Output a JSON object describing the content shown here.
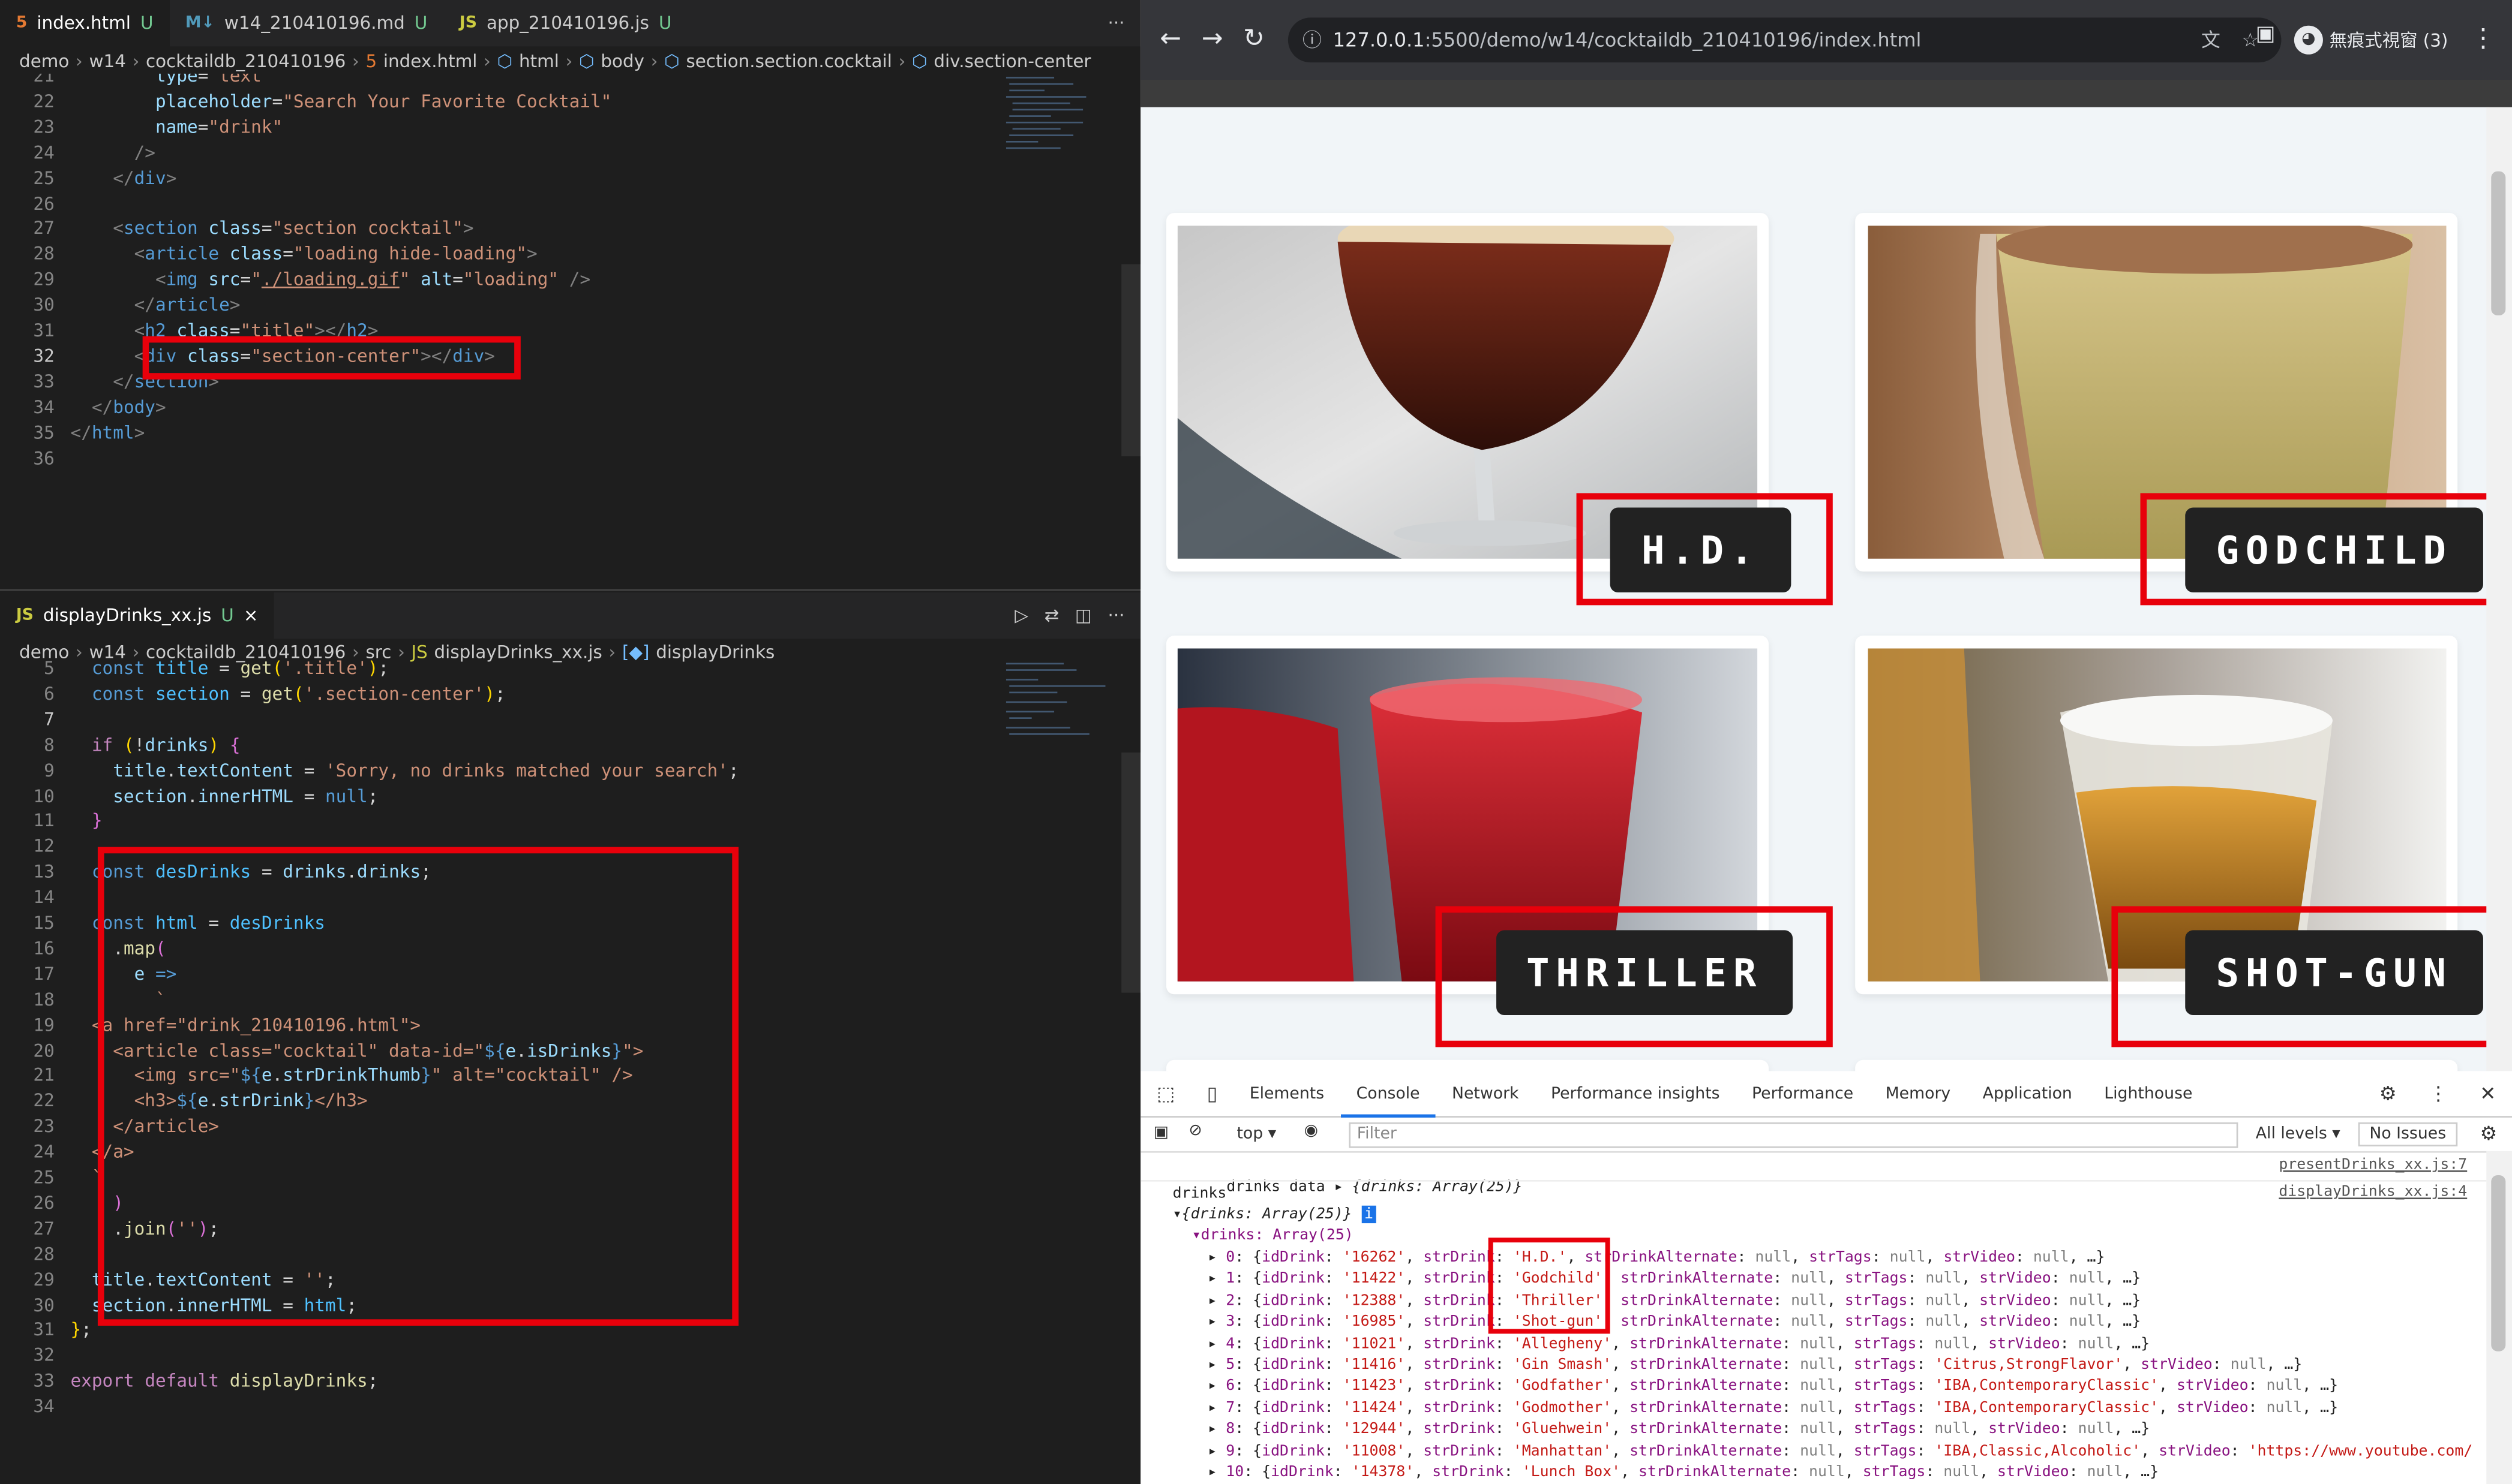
{
  "editor_top": {
    "tabs": [
      {
        "icon": "<>",
        "label": "index.html",
        "status": "U"
      },
      {
        "icon": "M↓",
        "label": "w14_210410196.md",
        "status": "U"
      },
      {
        "icon": "JS",
        "label": "app_210410196.js",
        "status": "U"
      }
    ],
    "more": "···",
    "breadcrumb": [
      "demo",
      "w14",
      "cocktaildb_210410196",
      "index.html",
      "html",
      "body",
      "section.section.cocktail",
      "div.section-center"
    ]
  },
  "editor_bottom": {
    "tab": {
      "icon": "JS",
      "label": "displayDrinks_xx.js",
      "status": "U",
      "close": "×"
    },
    "more": "···",
    "breadcrumb": [
      "demo",
      "w14",
      "cocktaildb_210410196",
      "src",
      "displayDrinks_xx.js",
      "displayDrinks"
    ]
  },
  "browser": {
    "url_host": "127.0.0.1",
    "url_rest": ":5500/demo/w14/cocktaildb_210410196/index.html",
    "profile": "無痕式視窗 (3)",
    "drinks": [
      "H.D.",
      "GODCHILD",
      "THRILLER",
      "SHOT-GUN"
    ]
  },
  "devtools": {
    "tabs": [
      "Elements",
      "Console",
      "Network",
      "Performance insights",
      "Performance",
      "Memory",
      "Application",
      "Lighthouse"
    ],
    "active_tab": "Console",
    "context": "top",
    "filter_placeholder": "Filter",
    "levels": "All levels",
    "issues": "No Issues",
    "log1_label": "drinks data",
    "log1_value": "{drinks: Array(25)}",
    "log1_src": "presentDrinks_xx.js:7",
    "log2_label": "drinks",
    "log2_src": "displayDrinks_xx.js:4",
    "log2_obj": "{drinks: Array(25)}",
    "log2_arr": "drinks: Array(25)",
    "rows": [
      {
        "i": "0",
        "id": "16262",
        "name": "H.D."
      },
      {
        "i": "1",
        "id": "11422",
        "name": "Godchild"
      },
      {
        "i": "2",
        "id": "12388",
        "name": "Thriller"
      },
      {
        "i": "3",
        "id": "16985",
        "name": "Shot-gun"
      },
      {
        "i": "4",
        "id": "11021",
        "name": "Allegheny"
      },
      {
        "i": "5",
        "id": "11416",
        "name": "Gin Smash",
        "tags": "'Citrus,StrongFlavor'"
      },
      {
        "i": "6",
        "id": "11423",
        "name": "Godfather",
        "tags": "'IBA,ContemporaryClassic'"
      },
      {
        "i": "7",
        "id": "11424",
        "name": "Godmother",
        "tags": "'IBA,ContemporaryClassic'"
      },
      {
        "i": "8",
        "id": "12944",
        "name": "Gluehwein"
      },
      {
        "i": "9",
        "id": "11008",
        "name": "Manhattan",
        "tags": "'IBA,Classic,Alcoholic'",
        "video": "'https://www.youtube.com/"
      },
      {
        "i": "10",
        "id": "14378",
        "name": "Lunch Box"
      }
    ]
  },
  "code_top": [
    {
      "n": "21",
      "html": "<span class='at'>        type</span><span class='pl'>=</span><span class='st'>\"text\"</span>"
    },
    {
      "n": "22",
      "html": "<span class='at'>        placeholder</span><span class='pl'>=</span><span class='st'>\"Search Your Favorite Cocktail\"</span>"
    },
    {
      "n": "23",
      "html": "<span class='at'>        name</span><span class='pl'>=</span><span class='st'>\"drink\"</span>"
    },
    {
      "n": "24",
      "html": "<span class='t'>      /></span>"
    },
    {
      "n": "25",
      "html": "<span class='t'>    &lt;/</span><span class='tg'>div</span><span class='t'>&gt;</span>"
    },
    {
      "n": "26",
      "html": ""
    },
    {
      "n": "27",
      "html": "<span class='t'>    &lt;</span><span class='tg'>section</span><span class='at'> class</span><span class='pl'>=</span><span class='st'>\"section cocktail\"</span><span class='t'>&gt;</span>"
    },
    {
      "n": "28",
      "html": "<span class='t'>      &lt;</span><span class='tg'>article</span><span class='at'> class</span><span class='pl'>=</span><span class='st'>\"loading hide-loading\"</span><span class='t'>&gt;</span>"
    },
    {
      "n": "29",
      "html": "<span class='t'>        &lt;</span><span class='tg'>img</span><span class='at'> src</span><span class='pl'>=</span><span class='st'>\"<u>./loading.gif</u>\"</span><span class='at'> alt</span><span class='pl'>=</span><span class='st'>\"loading\"</span><span class='t'> /&gt;</span>"
    },
    {
      "n": "30",
      "html": "<span class='t'>      &lt;/</span><span class='tg'>article</span><span class='t'>&gt;</span>"
    },
    {
      "n": "31",
      "html": "<span class='t'>      &lt;</span><span class='tg'>h2</span><span class='at'> class</span><span class='pl'>=</span><span class='st'>\"title\"</span><span class='t'>&gt;&lt;/</span><span class='tg'>h2</span><span class='t'>&gt;</span>"
    },
    {
      "n": "32",
      "html": "<span class='t'>      &lt;</span><span class='tg'>div</span><span class='at'> class</span><span class='pl'>=</span><span class='st'>\"section-center\"</span><span class='t'>&gt;&lt;/</span><span class='tg'>div</span><span class='t'>&gt;</span>"
    },
    {
      "n": "33",
      "html": "<span class='t'>    &lt;/</span><span class='tg'>section</span><span class='t'>&gt;</span>"
    },
    {
      "n": "34",
      "html": "<span class='t'>  &lt;/</span><span class='tg'>body</span><span class='t'>&gt;</span>"
    },
    {
      "n": "35",
      "html": "<span class='t'>&lt;/</span><span class='tg'>html</span><span class='t'>&gt;</span>"
    },
    {
      "n": "36",
      "html": ""
    }
  ],
  "code_bottom": [
    {
      "n": "5",
      "html": "<span class='kw'>  const</span><span class='vr'> title</span><span class='pl'> = </span><span class='fn'>get</span><span class='br'>(</span><span class='st'>'.title'</span><span class='br'>)</span><span class='pl'>;</span>"
    },
    {
      "n": "6",
      "html": "<span class='kw'>  const</span><span class='vr'> section</span><span class='pl'> = </span><span class='fn'>get</span><span class='br'>(</span><span class='st'>'.section-center'</span><span class='br'>)</span><span class='pl'>;</span>"
    },
    {
      "n": "7",
      "html": ""
    },
    {
      "n": "8",
      "html": "<span class='ctl'>  if</span><span class='pl'> </span><span class='br'>(</span><span class='pl'>!</span><span class='at'>drinks</span><span class='br'>)</span><span class='pl'> </span><span class='br2'>{</span>"
    },
    {
      "n": "9",
      "html": "<span class='at'>    title</span><span class='pl'>.</span><span class='at'>textContent</span><span class='pl'> = </span><span class='st'>'Sorry, no drinks matched your search'</span><span class='pl'>;</span>"
    },
    {
      "n": "10",
      "html": "<span class='at'>    section</span><span class='pl'>.</span><span class='at'>innerHTML</span><span class='pl'> = </span><span class='kw'>null</span><span class='pl'>;</span>"
    },
    {
      "n": "11",
      "html": "<span class='br2'>  }</span>"
    },
    {
      "n": "12",
      "html": ""
    },
    {
      "n": "13",
      "html": "<span class='kw'>  const</span><span class='vr'> desDrinks</span><span class='pl'> = </span><span class='at'>drinks</span><span class='pl'>.</span><span class='at'>drinks</span><span class='pl'>;</span>"
    },
    {
      "n": "14",
      "html": ""
    },
    {
      "n": "15",
      "html": "<span class='kw'>  const</span><span class='vr'> html</span><span class='pl'> = </span><span class='vr'>desDrinks</span>"
    },
    {
      "n": "16",
      "html": "<span class='pl'>    .</span><span class='fn'>map</span><span class='br2'>(</span>"
    },
    {
      "n": "17",
      "html": "<span class='at'>      e</span><span class='kw'> =&gt;</span>"
    },
    {
      "n": "18",
      "html": "<span class='st'>        `</span>"
    },
    {
      "n": "19",
      "html": "<span class='st'>  &lt;a href=\"drink_210410196.html\"&gt;</span>"
    },
    {
      "n": "20",
      "html": "<span class='st'>    &lt;article class=\"cocktail\" data-id=\"</span><span class='kw'>${</span><span class='at'>e</span><span class='pl'>.</span><span class='at'>isDrinks</span><span class='kw'>}</span><span class='st'>\"&gt;</span>"
    },
    {
      "n": "21",
      "html": "<span class='st'>      &lt;img src=\"</span><span class='kw'>${</span><span class='at'>e</span><span class='pl'>.</span><span class='at'>strDrinkThumb</span><span class='kw'>}</span><span class='st'>\" alt=\"cocktail\" /&gt;</span>"
    },
    {
      "n": "22",
      "html": "<span class='st'>      &lt;h3&gt;</span><span class='kw'>${</span><span class='at'>e</span><span class='pl'>.</span><span class='at'>strDrink</span><span class='kw'>}</span><span class='st'>&lt;/h3&gt;</span>"
    },
    {
      "n": "23",
      "html": "<span class='st'>    &lt;/article&gt;</span>"
    },
    {
      "n": "24",
      "html": "<span class='st'>  &lt;/a&gt;</span>"
    },
    {
      "n": "25",
      "html": "<span class='st'>  `</span>"
    },
    {
      "n": "26",
      "html": "<span class='br2'>    )</span>"
    },
    {
      "n": "27",
      "html": "<span class='pl'>    .</span><span class='fn'>join</span><span class='br2'>(</span><span class='st'>''</span><span class='br2'>)</span><span class='pl'>;</span>"
    },
    {
      "n": "28",
      "html": ""
    },
    {
      "n": "29",
      "html": "<span class='at'>  title</span><span class='pl'>.</span><span class='at'>textContent</span><span class='pl'> = </span><span class='st'>''</span><span class='pl'>;</span>"
    },
    {
      "n": "30",
      "html": "<span class='at'>  section</span><span class='pl'>.</span><span class='at'>innerHTML</span><span class='pl'> = </span><span class='vr'>html</span><span class='pl'>;</span>"
    },
    {
      "n": "31",
      "html": "<span class='br'>}</span><span class='pl'>;</span>"
    },
    {
      "n": "32",
      "html": ""
    },
    {
      "n": "33",
      "html": "<span class='ctl'>export</span><span class='ctl'> default</span><span class='fn'> displayDrinks</span><span class='pl'>;</span>"
    },
    {
      "n": "34",
      "html": ""
    }
  ]
}
